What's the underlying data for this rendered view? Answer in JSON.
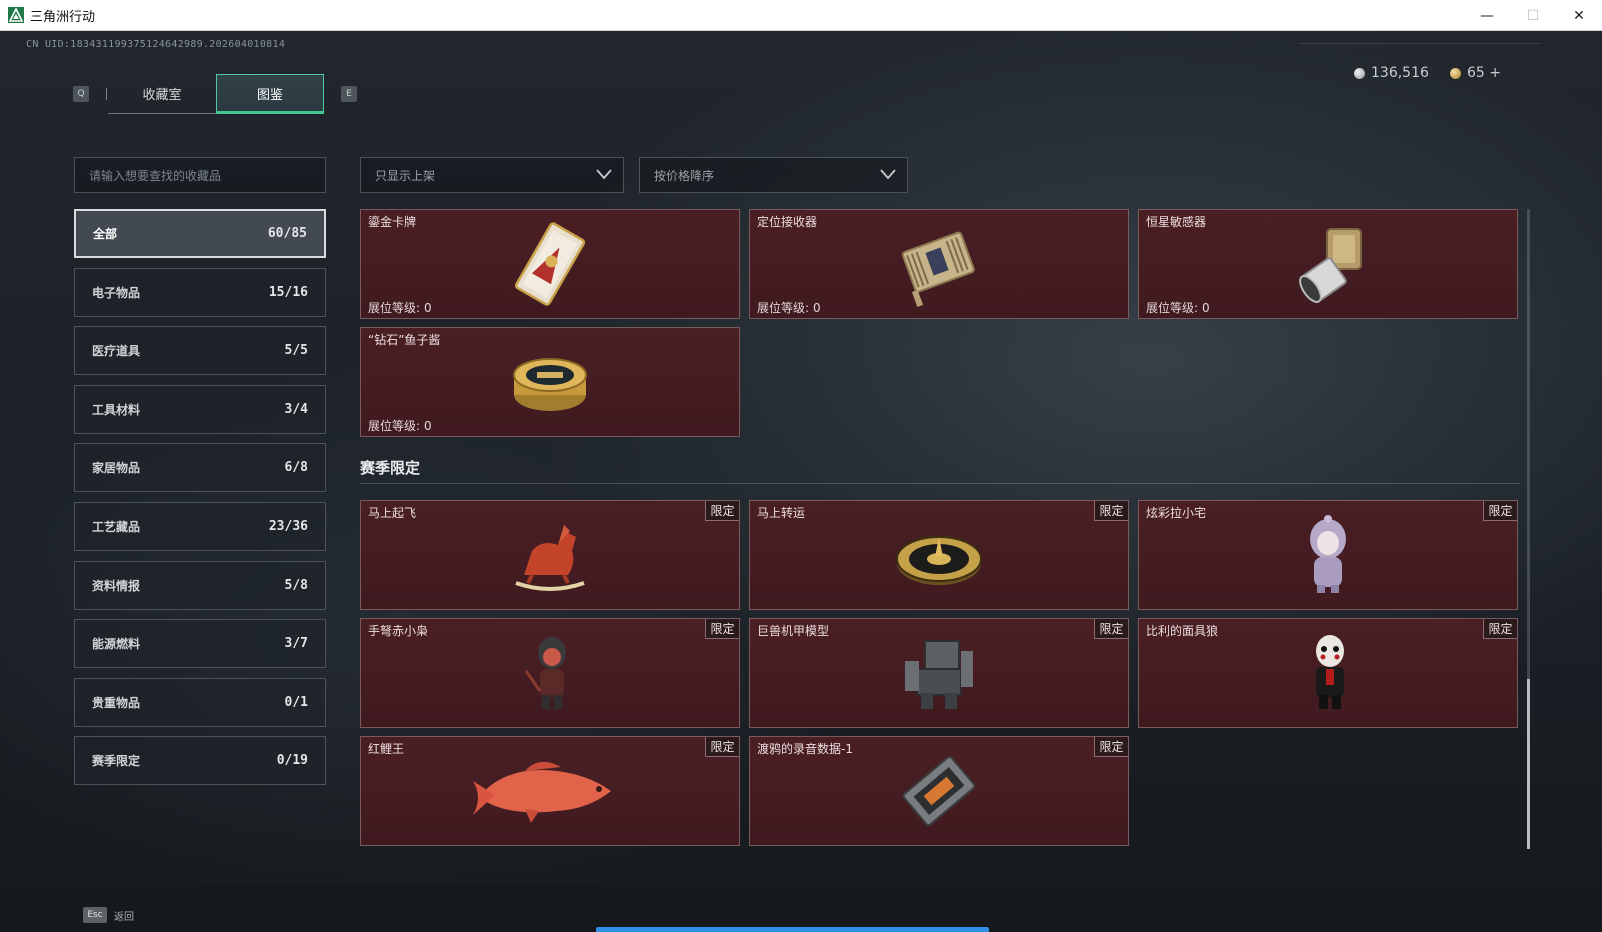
{
  "window": {
    "title": "三角洲行动",
    "minimize": "—",
    "maximize": "☐",
    "close": "✕"
  },
  "game": {
    "uid": "CN UID:1834311993751246429​89.202604010814",
    "tabs": {
      "prev_key": "Q",
      "next_key": "E",
      "collection": "收藏室",
      "codex": "图鉴"
    },
    "currency": {
      "silver": "136,516",
      "gold": "65 +"
    },
    "search_placeholder": "请输入想要查找的收藏品",
    "filter_label": "只显示上架",
    "sort_label": "按价格降序",
    "categories": [
      {
        "label": "全部",
        "count": "60/85"
      },
      {
        "label": "电子物品",
        "count": "15/16"
      },
      {
        "label": "医疗道具",
        "count": "5/5"
      },
      {
        "label": "工具材料",
        "count": "3/4"
      },
      {
        "label": "家居物品",
        "count": "6/8"
      },
      {
        "label": "工艺藏品",
        "count": "23/36"
      },
      {
        "label": "资料情报",
        "count": "5/8"
      },
      {
        "label": "能源燃料",
        "count": "3/7"
      },
      {
        "label": "贵重物品",
        "count": "0/1"
      },
      {
        "label": "赛季限定",
        "count": "0/19"
      }
    ],
    "level_label": "展位等级:",
    "level_value": "0",
    "items_top": [
      {
        "name": "鎏金卡牌",
        "icon": "gilded-card-icon"
      },
      {
        "name": "定位接收器",
        "icon": "locator-receiver-icon"
      },
      {
        "name": "恒星敏感器",
        "icon": "star-sensor-icon"
      },
      {
        "name": "“钻石”鱼子酱",
        "icon": "caviar-tin-icon"
      }
    ],
    "section_season": "赛季限定",
    "limited_badge": "限定",
    "items_season": [
      {
        "name": "马上起飞",
        "icon": "rocking-horse-icon"
      },
      {
        "name": "马上转运",
        "icon": "fortune-wheel-icon"
      },
      {
        "name": "炫彩拉小宅",
        "icon": "hoodie-figure-icon"
      },
      {
        "name": "手弩赤小枭",
        "icon": "crossbow-figure-icon"
      },
      {
        "name": "巨兽机甲模型",
        "icon": "mech-model-icon"
      },
      {
        "name": "比利的面具狼",
        "icon": "billy-mask-figure-icon"
      },
      {
        "name": "红鲤王",
        "icon": "red-carp-icon"
      },
      {
        "name": "渡鸦的录音数据-1",
        "icon": "data-cartridge-icon"
      }
    ],
    "esc_key": "Esc",
    "esc_label": "返回",
    "colors": {
      "card_bg": "#4a1f24",
      "accent_green": "#3fc890",
      "progress_blue": "#2f8fe6"
    }
  }
}
